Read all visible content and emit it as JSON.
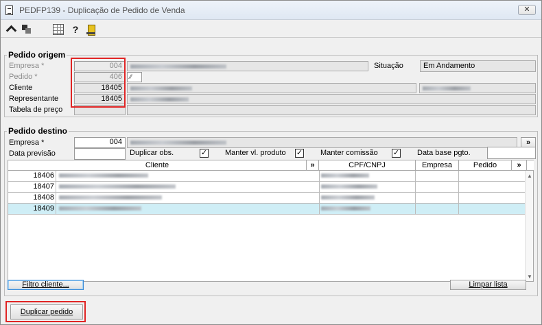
{
  "window": {
    "title": "PEDFP139 - Duplicação de Pedido de Venda",
    "close_glyph": "✕",
    "icon": "document-icon"
  },
  "toolbar": {
    "icons": [
      "arrow-return-icon",
      "copy-icon",
      "calendar-grid-icon",
      "help-icon",
      "exit-door-icon"
    ],
    "help_glyph": "?"
  },
  "origem": {
    "legend": "Pedido origem",
    "empresa_label": "Empresa *",
    "empresa_value": "004",
    "pedido_label": "Pedido *",
    "pedido_value": "406",
    "pedido_lookup_glyph": "⁄⁄",
    "cliente_label": "Cliente",
    "cliente_value": "18405",
    "representante_label": "Representante",
    "representante_value": "18405",
    "tabela_label": "Tabela de preço",
    "situacao_label": "Situação",
    "situacao_value": "Em Andamento"
  },
  "destino": {
    "legend": "Pedido destino",
    "empresa_label": "Empresa *",
    "empresa_value": "004",
    "expand_glyph": "»",
    "data_previsao_label": "Data previsão",
    "data_previsao_value": "",
    "duplicar_obs_label": "Duplicar obs.",
    "duplicar_obs_checked": "✓",
    "manter_vl_label": "Manter vl. produto",
    "manter_vl_checked": "✓",
    "manter_comissao_label": "Manter comissão",
    "manter_comissao_checked": "✓",
    "data_base_label": "Data base pgto.",
    "data_base_value": ""
  },
  "grid": {
    "headers": {
      "cliente": "Cliente",
      "cpf": "CPF/CNPJ",
      "empresa": "Empresa",
      "pedido": "Pedido",
      "more": "»"
    },
    "rows": [
      {
        "code": "18406",
        "selected": false
      },
      {
        "code": "18407",
        "selected": false
      },
      {
        "code": "18408",
        "selected": false
      },
      {
        "code": "18409",
        "selected": true
      }
    ],
    "scroll_up": "▲",
    "scroll_down": "▼"
  },
  "buttons": {
    "filtro_cliente": "Filtro cliente...",
    "limpar_lista": "Limpar lista",
    "duplicar_pedido": "Duplicar pedido"
  }
}
